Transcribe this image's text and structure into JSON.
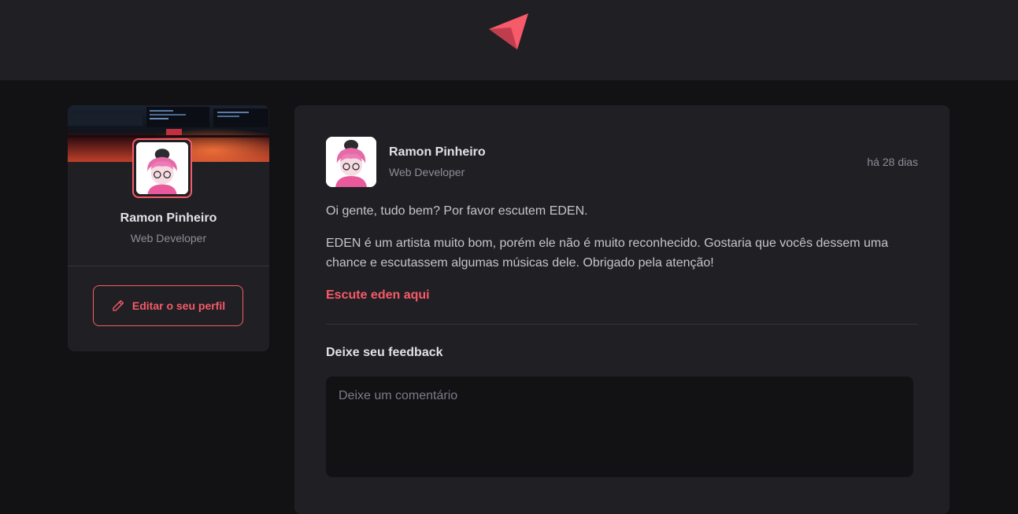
{
  "app": {
    "logo_icon": "ignite-logo-icon"
  },
  "colors": {
    "accent": "#f75a68",
    "background": "#121214",
    "surface": "#202024"
  },
  "sidebar": {
    "cover_icon": "cover-image",
    "avatar_icon": "avatar-image",
    "name": "Ramon Pinheiro",
    "role": "Web Developer",
    "edit_button": {
      "label": "Editar o seu perfil",
      "icon": "pencil-icon"
    }
  },
  "post": {
    "author": {
      "name": "Ramon Pinheiro",
      "role": "Web Developer"
    },
    "time": "há 28 dias",
    "paragraphs": [
      "Oi gente, tudo bem? Por favor escutem EDEN.",
      "EDEN é um artista muito bom, porém ele não é muito reconhecido. Gostaria que vocês dessem uma chance e escutassem algumas músicas dele. Obrigado pela atenção!"
    ],
    "link": "Escute eden aqui",
    "feedback_title": "Deixe seu feedback",
    "comment_placeholder": "Deixe um comentário"
  }
}
